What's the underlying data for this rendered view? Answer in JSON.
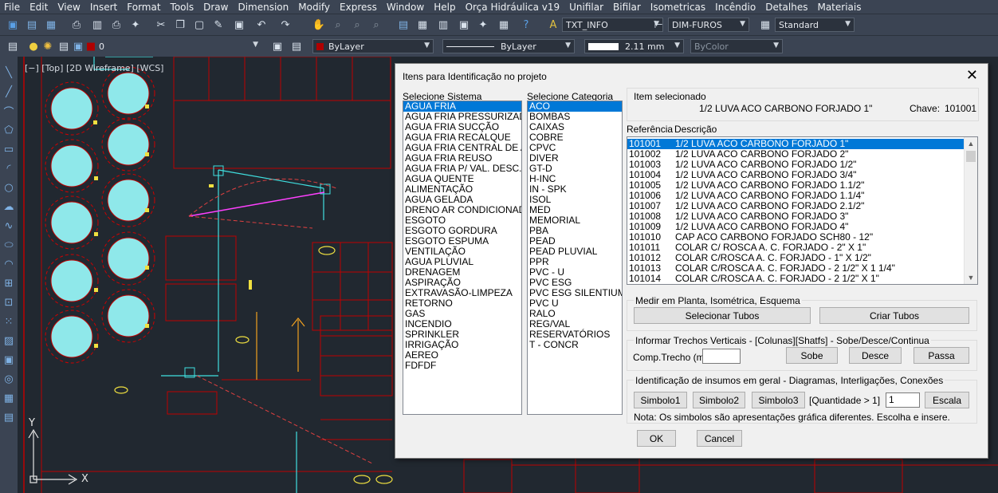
{
  "menu": [
    "File",
    "Edit",
    "View",
    "Insert",
    "Format",
    "Tools",
    "Draw",
    "Dimension",
    "Modify",
    "Express",
    "Window",
    "Help",
    "Orça Hidráulica v19",
    "Unifilar",
    "Bifilar",
    "Isometricas",
    "Incêndio",
    "Detalhes",
    "Materiais"
  ],
  "toolbar": {
    "text_style": "TXT_INFO",
    "dim_style": "DIM-FUROS",
    "table_style": "Standard",
    "layer": "0",
    "color": "ByLayer",
    "linetype": "ByLayer",
    "lineweight": "2.11 mm",
    "plotstyle": "ByColor"
  },
  "viewport_label": "[−] [Top] [2D Wireframe] [WCS]",
  "ucs": {
    "y": "Y",
    "x": "X"
  },
  "dialog": {
    "title": "Itens para Identificação no projeto",
    "sistema_label": "Selecione Sistema",
    "sistemas": [
      "AGUA FRIA",
      "AGUA FRIA PRESSURIZADA",
      "AGUA FRIA SUCÇÃO",
      "AGUA FRIA RECALQUE",
      "AGUA FRIA CENTRAL DE AQ",
      "AGUA FRIA REUSO",
      "AGUA FRIA P/ VAL. DESC.",
      "AGUA QUENTE",
      "ALIMENTAÇÃO",
      "AGUA GELADA",
      "DRENO AR CONDICIONADO",
      "ESGOTO",
      "ESGOTO GORDURA",
      "ESGOTO ESPUMA",
      "VENTILAÇÃO",
      "AGUA PLUVIAL",
      "DRENAGEM",
      "ASPIRAÇÃO",
      "EXTRAVASÃO-LIMPEZA",
      "RETORNO",
      "GAS",
      "INCENDIO",
      "SPRINKLER",
      "IRRIGAÇÃO",
      "AEREO",
      "FDFDF"
    ],
    "categoria_label": "Selecione Categoria",
    "categorias": [
      "ACO",
      "BOMBAS",
      "CAIXAS",
      "COBRE",
      "CPVC",
      "DIVER",
      "GT-D",
      "H-INC",
      "IN - SPK",
      "ISOL",
      "MED",
      "MEMORIAL",
      "PBA",
      "PEAD",
      "PEAD PLUVIAL",
      "PPR",
      "PVC - U",
      "PVC ESG",
      "PVC ESG SILENTIUM",
      "PVC U",
      "RALO",
      "REG/VAL",
      "RESERVATÓRIOS",
      "T - CONCR"
    ],
    "item_label": "Item selecionado",
    "item_value": "1/2 LUVA ACO CARBONO FORJADO   1\"",
    "chave_label": "Chave:",
    "chave_value": "101001",
    "ref_header": "Referência",
    "desc_header": "Descrição",
    "items": [
      [
        "101001",
        "1/2 LUVA ACO CARBONO FORJADO   1\""
      ],
      [
        "101002",
        "1/2 LUVA ACO CARBONO FORJADO   2\""
      ],
      [
        "101003",
        "1/2 LUVA ACO CARBONO FORJADO  1/2\""
      ],
      [
        "101004",
        "1/2 LUVA ACO CARBONO FORJADO  3/4\""
      ],
      [
        "101005",
        "1/2 LUVA ACO CARBONO FORJADO 1.1/2\""
      ],
      [
        "101006",
        "1/2 LUVA ACO CARBONO FORJADO 1.1/4\""
      ],
      [
        "101007",
        "1/2 LUVA ACO CARBONO FORJADO 2.1/2\""
      ],
      [
        "101008",
        "1/2 LUVA ACO CARBONO FORJADO 3\""
      ],
      [
        "101009",
        "1/2 LUVA ACO CARBONO FORJADO 4\""
      ],
      [
        "101010",
        "CAP ACO CARBONO FORJADO SCH80 - 12\""
      ],
      [
        "101011",
        "COLAR C/ ROSCA A. C. FORJADO - 2\" X 1\""
      ],
      [
        "101012",
        "COLAR C/ROSCA A. C. FORJADO - 1\" X 1/2\""
      ],
      [
        "101013",
        "COLAR C/ROSCA A. C. FORJADO - 2 1/2\" X 1 1/4\""
      ],
      [
        "101014",
        "COLAR C/ROSCA A. C. FORJADO - 2 1/2\" X 1\""
      ]
    ],
    "medir_label": "Medir em Planta, Isométrica, Esquema",
    "selecionar_tubos": "Selecionar Tubos",
    "criar_tubos": "Criar Tubos",
    "trechos_label": "Informar Trechos Verticais - [Colunas][Shatfs] - Sobe/Desce/Continua",
    "comp_label": "Comp.Trecho (m)",
    "comp_value": "",
    "sobe": "Sobe",
    "desce": "Desce",
    "passa": "Passa",
    "insumos_label": "Identificação de insumos em geral - Diagramas, Interligações, Conexões",
    "simbolo1": "Simbolo1",
    "simbolo2": "Simbolo2",
    "simbolo3": "Simbolo3",
    "quantidade_label": "[Quantidade > 1]",
    "quantidade_value": "1",
    "escala": "Escala",
    "nota": "Nota: Os simbolos são apresentações gráfica diferentes. Escolha e insere.",
    "ok": "OK",
    "cancel": "Cancel"
  }
}
